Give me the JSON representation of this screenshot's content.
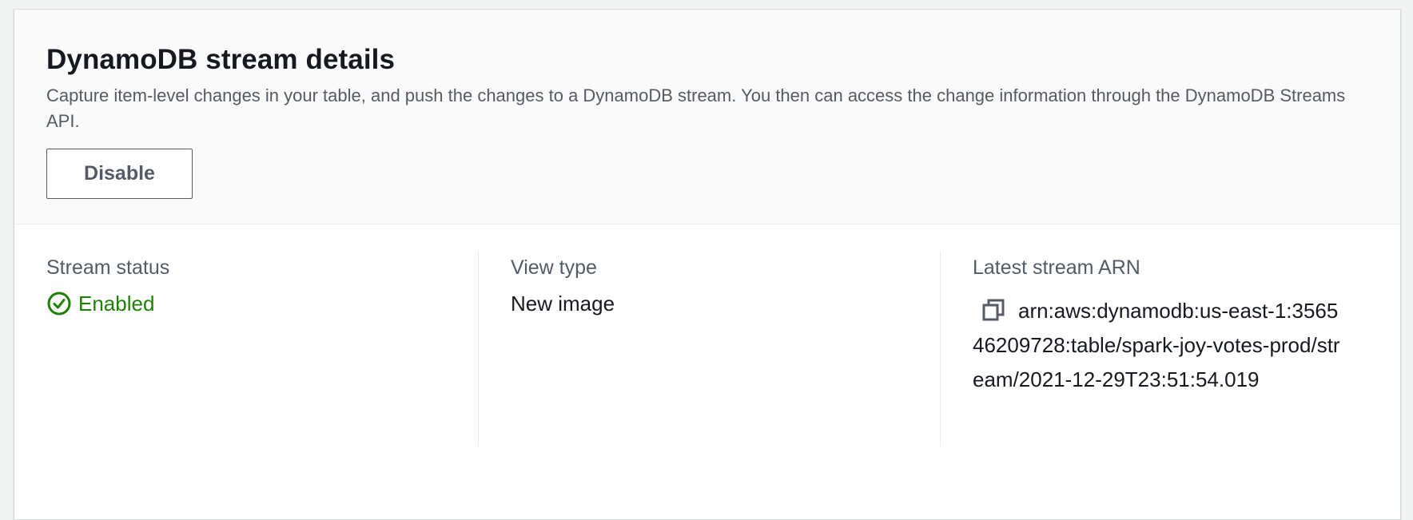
{
  "panel": {
    "title": "DynamoDB stream details",
    "description": "Capture item-level changes in your table, and push the changes to a DynamoDB stream. You then can access the change information through the DynamoDB Streams API.",
    "disable_label": "Disable"
  },
  "details": {
    "stream_status": {
      "label": "Stream status",
      "value": "Enabled",
      "icon": "check-circle-icon",
      "color": "#1d8102"
    },
    "view_type": {
      "label": "View type",
      "value": "New image"
    },
    "latest_stream_arn": {
      "label": "Latest stream ARN",
      "value": "arn:aws:dynamodb:us-east-1:356546209728:table/spark-joy-votes-prod/stream/2021-12-29T23:51:54.019",
      "icon": "copy-icon"
    }
  }
}
